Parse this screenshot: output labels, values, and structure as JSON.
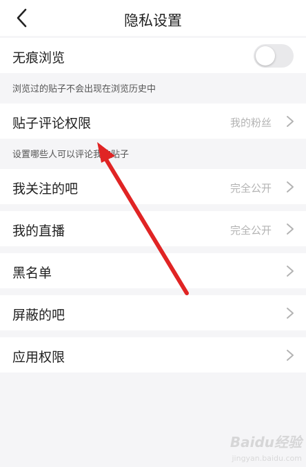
{
  "header": {
    "title": "隐私设置",
    "back_icon": "chevron-left-icon"
  },
  "incognito": {
    "label": "无痕浏览",
    "enabled": false,
    "hint": "浏览过的贴子不会出现在浏览历史中"
  },
  "comment_permission": {
    "label": "贴子评论权限",
    "value": "我的粉丝",
    "hint": "设置哪些人可以评论我的贴子"
  },
  "settings": [
    {
      "label": "我关注的吧",
      "value": "完全公开"
    },
    {
      "label": "我的直播",
      "value": "完全公开"
    },
    {
      "label": "黑名单",
      "value": ""
    },
    {
      "label": "屏蔽的吧",
      "value": ""
    },
    {
      "label": "应用权限",
      "value": ""
    }
  ],
  "annotation": {
    "arrow_color": "#e02424"
  },
  "watermark": {
    "logo": "Baidu经验",
    "url": "jingyan.baidu.com"
  },
  "colors": {
    "background": "#f5f5f7",
    "row": "#ffffff",
    "secondary_text": "#b3b3b3"
  }
}
